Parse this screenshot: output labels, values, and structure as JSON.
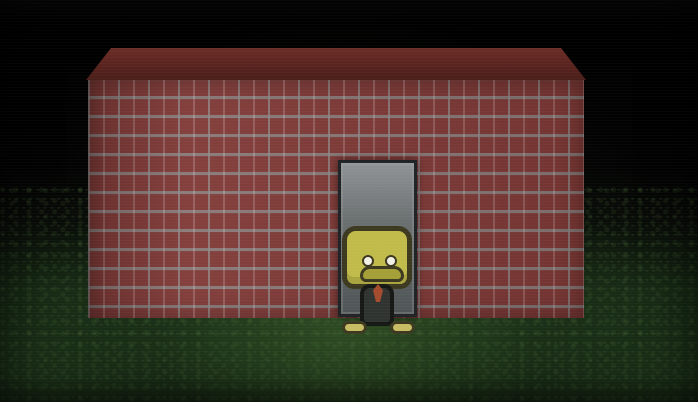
{
  "scene": {
    "icon_name": "night-brick-building-scene",
    "colors": {
      "sky": "#000000",
      "grass": "#1d3419",
      "brick": "#803a37",
      "door": "#6b7071",
      "character_face": "#c1bb4b"
    }
  }
}
